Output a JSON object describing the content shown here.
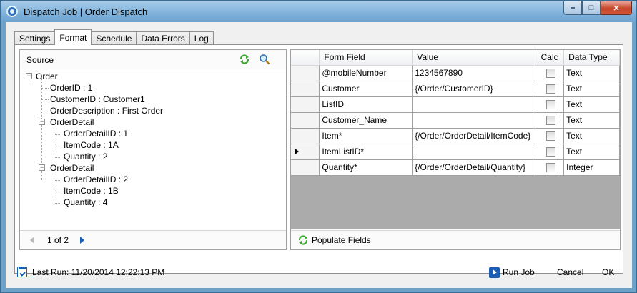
{
  "window": {
    "title": "Dispatch Job | Order Dispatch"
  },
  "tabs": [
    {
      "label": "Settings",
      "active": false
    },
    {
      "label": "Format",
      "active": true
    },
    {
      "label": "Schedule",
      "active": false
    },
    {
      "label": "Data Errors",
      "active": false
    },
    {
      "label": "Log",
      "active": false
    }
  ],
  "source": {
    "title": "Source",
    "tree": [
      {
        "label": "Order",
        "expander": "−"
      },
      {
        "label": "OrderID : 1"
      },
      {
        "label": "CustomerID : Customer1"
      },
      {
        "label": "OrderDescription : First Order"
      },
      {
        "label": "OrderDetail",
        "expander": "−"
      },
      {
        "label": "OrderDetailID : 1"
      },
      {
        "label": "ItemCode : 1A"
      },
      {
        "label": "Quantity : 2"
      },
      {
        "label": "OrderDetail",
        "expander": "−"
      },
      {
        "label": "OrderDetailID : 2"
      },
      {
        "label": "ItemCode : 1B"
      },
      {
        "label": "Quantity : 4"
      }
    ],
    "pager": {
      "text": "1 of 2"
    }
  },
  "grid": {
    "columns": {
      "form_field": "Form Field",
      "value": "Value",
      "calc": "Calc",
      "data_type": "Data Type"
    },
    "rows": [
      {
        "form_field": "@mobileNumber",
        "value": "1234567890",
        "calc": false,
        "data_type": "Text"
      },
      {
        "form_field": "Customer",
        "value": "{/Order/CustomerID}",
        "calc": false,
        "data_type": "Text"
      },
      {
        "form_field": "ListID",
        "value": "",
        "calc": false,
        "data_type": "Text"
      },
      {
        "form_field": "Customer_Name",
        "value": "",
        "calc": false,
        "data_type": "Text"
      },
      {
        "form_field": "Item*",
        "value": "{/Order/OrderDetail/ItemCode}",
        "calc": false,
        "data_type": "Text"
      },
      {
        "form_field": "ItemListID*",
        "value": "",
        "calc": false,
        "data_type": "Text",
        "current": true
      },
      {
        "form_field": "Quantity*",
        "value": "{/Order/OrderDetail/Quantity}",
        "calc": false,
        "data_type": "Integer"
      }
    ],
    "populate_label": "Populate Fields"
  },
  "footer": {
    "last_run": "Last Run: 11/20/2014 12:22:13 PM",
    "run_job": "Run Job",
    "cancel": "Cancel",
    "ok": "OK"
  }
}
